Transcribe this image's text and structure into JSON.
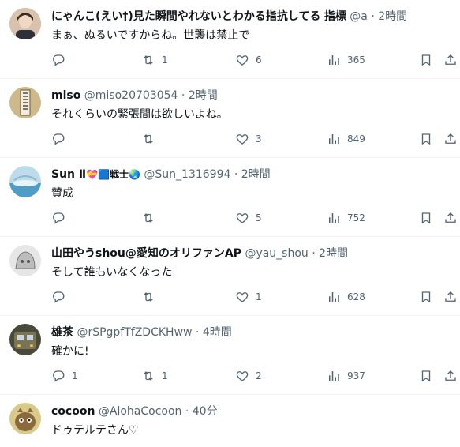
{
  "tweets": [
    {
      "name": "にゃんこ(えい†)見た瞬間やれないとわかる指抗してる",
      "suffix": "指標",
      "handle": "@a",
      "time": "2時間",
      "text": "まぁ、ぬるいですからね。世襲は禁止で",
      "reply_count": "",
      "retweet_count": "1",
      "like_count": "6",
      "view_count": "365",
      "avatar_color": "#c9a98c"
    },
    {
      "name": "miso",
      "handle": "@miso20703054",
      "time": "2時間",
      "text": "それくらいの緊張間は欲しいよね。",
      "reply_count": "",
      "retweet_count": "",
      "like_count": "3",
      "view_count": "849",
      "avatar_color": "#b8a46a"
    },
    {
      "name": "Sun Ⅱ",
      "badges": "💝🟦戦士🌏",
      "handle": "@Sun_1316994",
      "time": "2時間",
      "text": "賛成",
      "reply_count": "",
      "retweet_count": "",
      "like_count": "5",
      "view_count": "752",
      "avatar_color": "#9fc7dd"
    },
    {
      "name": "山田やうshou@愛知のオリファンAP",
      "handle": "@yau_shou",
      "time": "2時間",
      "text": "そして誰もいなくなった",
      "reply_count": "",
      "retweet_count": "",
      "like_count": "1",
      "view_count": "628",
      "avatar_color": "#c8c8c8"
    },
    {
      "name": "雄茶",
      "handle": "@rSPgpfTfZDCKHww",
      "time": "4時間",
      "text": "確かに!",
      "reply_count": "1",
      "retweet_count": "1",
      "like_count": "2",
      "view_count": "937",
      "avatar_color": "#6c6c4c"
    },
    {
      "name": "cocoon",
      "handle": "@AlohaCocoon",
      "time": "40分",
      "text": "ドゥテルテさん♡",
      "avatar_color": "#9a8a4c"
    }
  ],
  "separator": " · ",
  "icons": [
    "reply-icon",
    "retweet-icon",
    "like-icon",
    "views-icon",
    "bookmark-icon",
    "share-icon"
  ]
}
